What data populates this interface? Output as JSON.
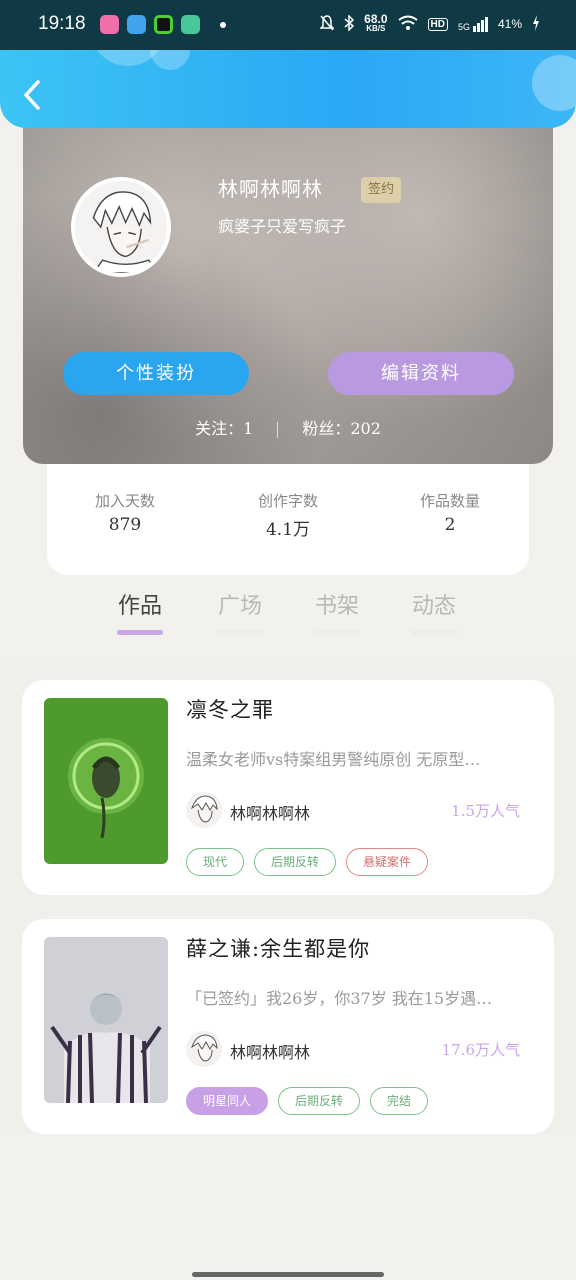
{
  "status_bar": {
    "time": "19:18",
    "net_speed": "68.0",
    "net_unit": "KB/S",
    "hd": "HD",
    "signal": "5G",
    "battery": "41%",
    "app_colors": [
      "#f06fa8",
      "#3fa3ee",
      "#4ad12d",
      "#48c79a"
    ]
  },
  "header": {
    "back_icon": "chevron-left-icon"
  },
  "profile": {
    "name": "林啊林啊林",
    "badge": "签约",
    "bio": "疯婆子只爱写疯子",
    "dress_button": "个性装扮",
    "edit_button": "编辑资料",
    "follow_label": "关注：",
    "follow_count": "1",
    "fans_label": "粉丝：",
    "fans_count": "202"
  },
  "stats": [
    {
      "label": "加入天数",
      "value": "879"
    },
    {
      "label": "创作字数",
      "value": "4.1万"
    },
    {
      "label": "作品数量",
      "value": "2"
    }
  ],
  "tabs": [
    {
      "label": "作品",
      "active": true
    },
    {
      "label": "广场",
      "active": false
    },
    {
      "label": "书架",
      "active": false
    },
    {
      "label": "动态",
      "active": false
    }
  ],
  "works": [
    {
      "title": "凛冬之罪",
      "desc": "温柔女老师vs特案组男警纯原创 无原型…",
      "author": "林啊林啊林",
      "popularity": "1.5万人气",
      "tags": [
        {
          "label": "现代",
          "style": "green"
        },
        {
          "label": "后期反转",
          "style": "green"
        },
        {
          "label": "悬疑案件",
          "style": "red"
        }
      ]
    },
    {
      "title": "薛之谦:余生都是你",
      "desc": "「已签约」我26岁，你37岁 我在15岁遇…",
      "author": "林啊林啊林",
      "popularity": "17.6万人气",
      "tags": [
        {
          "label": "明星同人",
          "style": "purple"
        },
        {
          "label": "后期反转",
          "style": "green"
        },
        {
          "label": "完结",
          "style": "green"
        }
      ]
    }
  ]
}
